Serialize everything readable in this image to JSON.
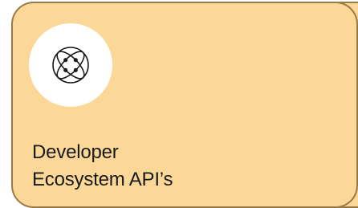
{
  "card": {
    "title_line1": "Developer",
    "title_line2": "Ecosystem API’s",
    "icon": "atom-network-icon",
    "background_color": "#fbd898",
    "border_color": "#9a7a48"
  }
}
